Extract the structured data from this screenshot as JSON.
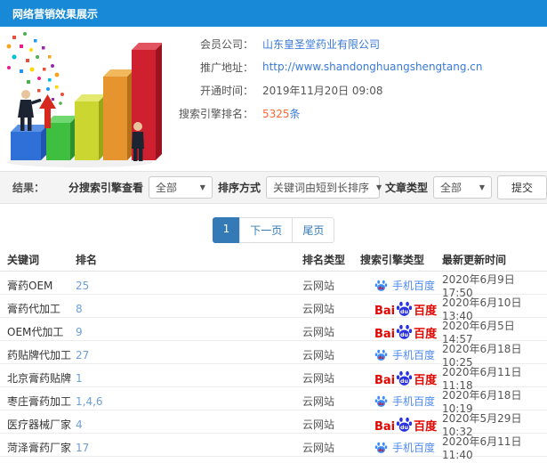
{
  "header": {
    "title": "网络营销效果展示"
  },
  "info": {
    "rows": [
      {
        "label": "会员公司：",
        "value": "山东皇圣堂药业有限公司"
      },
      {
        "label": "推广地址：",
        "value": "http://www.shandonghuangshengtang.cn"
      },
      {
        "label": "开通时间：",
        "value": "2019年11月20日 09:08"
      },
      {
        "label": "搜索引擎排名：",
        "number": "5325",
        "unit": "条"
      }
    ]
  },
  "filters": {
    "result_label": "结果：",
    "engine_label": "分搜索引擎查看",
    "engine_value": "全部",
    "sort_label": "排序方式",
    "sort_value": "关键词由短到长排序",
    "article_label": "文章类型",
    "article_value": "全部",
    "submit_label": "提交",
    "caret": "▼"
  },
  "pagination": {
    "current": "1",
    "next": "下一页",
    "last": "尾页"
  },
  "table": {
    "headers": [
      "关键词",
      "排名",
      "排名类型",
      "搜索引擎类型",
      "最新更新时间"
    ],
    "engine_labels": {
      "mobile": "手机百度",
      "baidu_bai": "Bai",
      "baidu_du": "du",
      "baidu_cn": "百度"
    },
    "rows": [
      {
        "keyword": "膏药OEM",
        "rank": "25",
        "rank_type": "云网站",
        "engine": "mobile",
        "updated": "2020年6月9日 17:50"
      },
      {
        "keyword": "膏药代加工",
        "rank": "8",
        "rank_type": "云网站",
        "engine": "baidu",
        "updated": "2020年6月10日 13:40"
      },
      {
        "keyword": "OEM代加工",
        "rank": "9",
        "rank_type": "云网站",
        "engine": "baidu",
        "updated": "2020年6月5日 14:57"
      },
      {
        "keyword": "药贴牌代加工",
        "rank": "27",
        "rank_type": "云网站",
        "engine": "mobile",
        "updated": "2020年6月18日 10:25"
      },
      {
        "keyword": "北京膏药贴牌",
        "rank": "1",
        "rank_type": "云网站",
        "engine": "baidu",
        "updated": "2020年6月11日 11:18"
      },
      {
        "keyword": "枣庄膏药加工",
        "rank": "1,4,6",
        "rank_type": "云网站",
        "engine": "mobile",
        "updated": "2020年6月18日 10:19"
      },
      {
        "keyword": "医疗器械厂家",
        "rank": "4",
        "rank_type": "云网站",
        "engine": "baidu",
        "updated": "2020年5月29日 10:32"
      },
      {
        "keyword": "菏泽膏药厂家",
        "rank": "17",
        "rank_type": "云网站",
        "engine": "mobile",
        "updated": "2020年6月11日 11:40"
      }
    ]
  },
  "colors": {
    "header_bg": "#1789d6",
    "link_blue": "#3a7ad9",
    "rank_blue": "#6d9fd8",
    "highlight_orange": "#ff6633",
    "baidu_red": "#e10601",
    "baidu_paw_blue": "#2932e1",
    "mobile_blue": "#4e8cf0",
    "pagination_blue": "#337ab7"
  }
}
